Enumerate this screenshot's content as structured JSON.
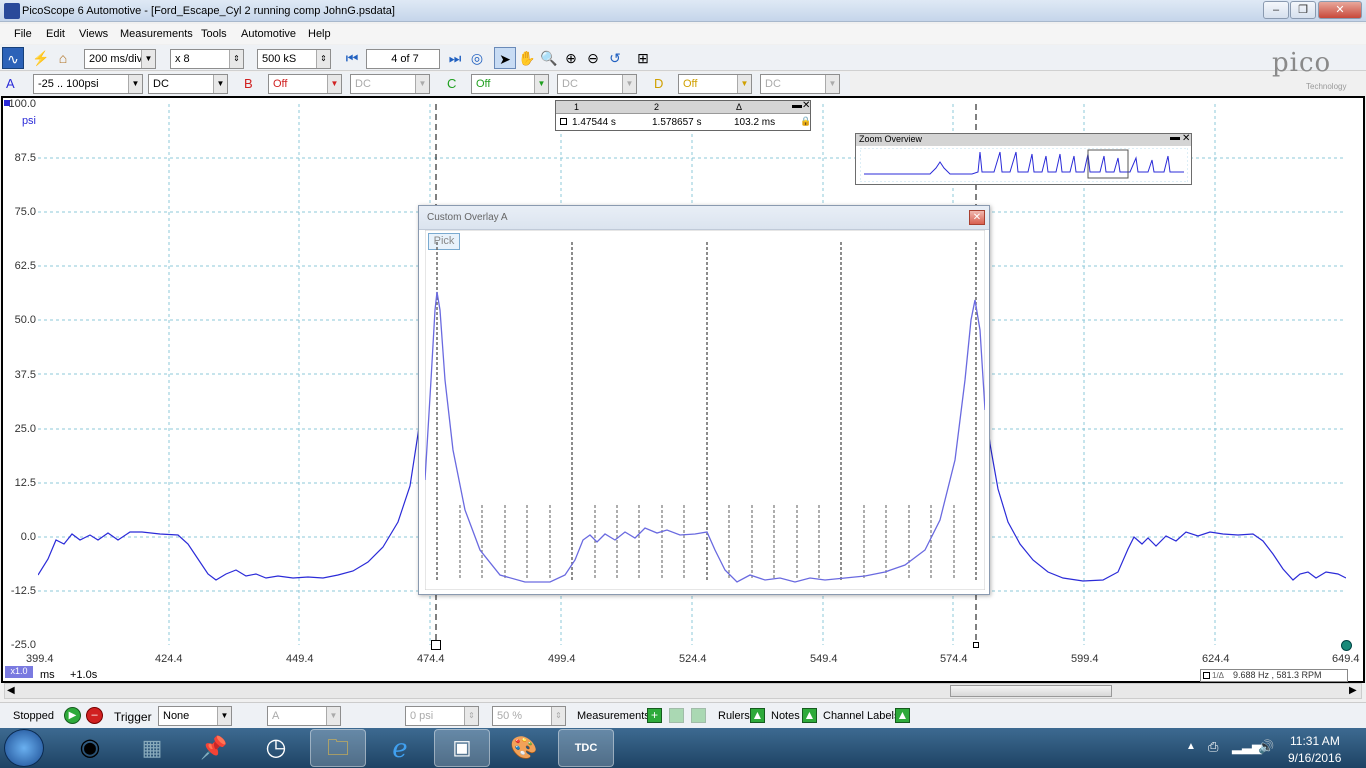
{
  "window": {
    "title": "PicoScope 6 Automotive - [Ford_Escape_Cyl 2 running comp JohnG.psdata]"
  },
  "menu": [
    "File",
    "Edit",
    "Views",
    "Measurements",
    "Tools",
    "Automotive",
    "Help"
  ],
  "toolbar": {
    "timebase": "200 ms/div",
    "zoom": "x 8",
    "samples": "500 kS",
    "capture": "4 of 7"
  },
  "channels": {
    "a_label": "A",
    "a_range": "-25 .. 100psi",
    "a_coupling": "DC",
    "b_label": "B",
    "b_range": "Off",
    "b_coupling": "DC",
    "c_label": "C",
    "c_range": "Off",
    "c_coupling": "DC",
    "d_label": "D",
    "d_range": "Off",
    "d_coupling": "DC"
  },
  "brand": {
    "logo": "pico",
    "sub": "Technology"
  },
  "y_axis": {
    "unit": "psi",
    "ticks": [
      "100.0",
      "87.5",
      "75.0",
      "62.5",
      "50.0",
      "37.5",
      "25.0",
      "12.5",
      "0.0",
      "-12.5",
      "-25.0"
    ]
  },
  "x_axis": {
    "ticks": [
      "399.4",
      "424.4",
      "449.4",
      "474.4",
      "499.4",
      "524.4",
      "549.4",
      "574.4",
      "599.4",
      "624.4",
      "649.4"
    ],
    "unit": "ms",
    "offset": "+1.0s",
    "zoom_badge": "x1.0"
  },
  "rulers": {
    "col1": "1",
    "col2": "2",
    "col3": "Δ",
    "val1": "1.47544 s",
    "val2": "1.578657 s",
    "val3": "103.2 ms"
  },
  "zoom_overview": {
    "title": "Zoom Overview"
  },
  "overlay": {
    "title": "Custom Overlay A",
    "pick": "Pick"
  },
  "freq_readout": "9.688 Hz , 581.3 RPM",
  "status": {
    "state": "Stopped",
    "trigger_label": "Trigger",
    "trigger_mode": "None",
    "trigger_channel": "A",
    "threshold": "0 psi",
    "pretrigger": "50 %",
    "measurements": "Measurements",
    "rulers": "Rulers",
    "notes": "Notes",
    "channel_labels": "Channel Labels"
  },
  "clock": {
    "time": "11:31 AM",
    "date": "9/16/2016"
  },
  "colors": {
    "trace": "#2b2bd8",
    "grid": "#8cc8d8",
    "overlay_trace": "#6a6ae0"
  }
}
